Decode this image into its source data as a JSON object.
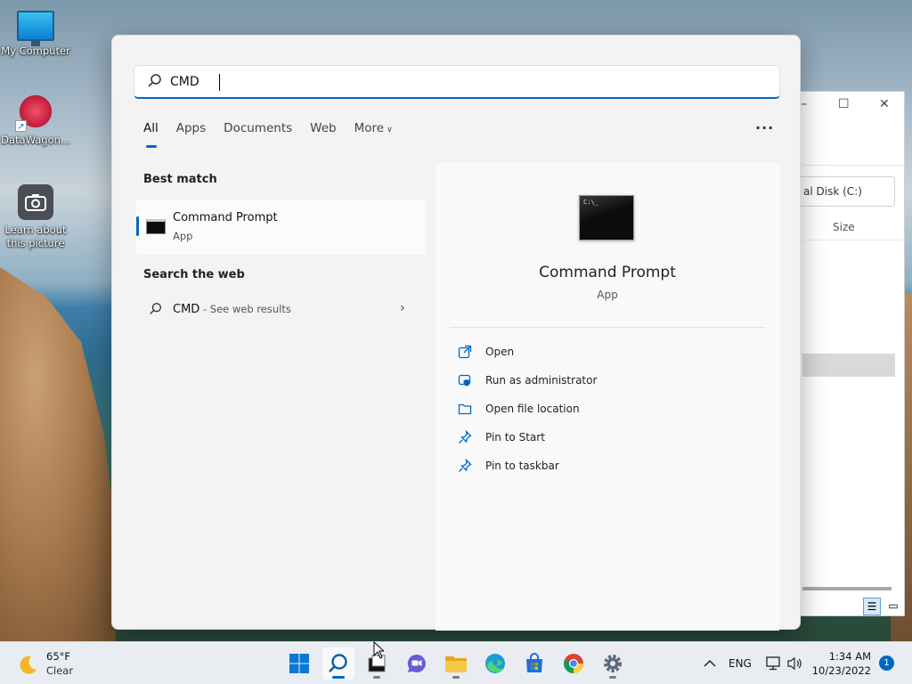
{
  "desktop": {
    "icons": [
      {
        "label": "My Computer"
      },
      {
        "label": "DataWagon..."
      },
      {
        "label": "Learn about this picture"
      }
    ]
  },
  "explorer": {
    "address": "al Disk (C:)",
    "column_size": "Size"
  },
  "search": {
    "query": "CMD",
    "tabs": [
      {
        "label": "All",
        "active": true
      },
      {
        "label": "Apps"
      },
      {
        "label": "Documents"
      },
      {
        "label": "Web"
      },
      {
        "label": "More"
      }
    ],
    "more_options": "···",
    "best_match_title": "Best match",
    "best_match": {
      "name": "Command Prompt",
      "type": "App",
      "icon": "cmd-icon"
    },
    "web_title": "Search the web",
    "web_result": {
      "query": "CMD",
      "hint": " - See web results"
    },
    "preview": {
      "name": "Command Prompt",
      "type": "App",
      "actions": [
        {
          "label": "Open",
          "icon": "open-icon"
        },
        {
          "label": "Run as administrator",
          "icon": "admin-icon"
        },
        {
          "label": "Open file location",
          "icon": "folder-icon"
        },
        {
          "label": "Pin to Start",
          "icon": "pin-icon"
        },
        {
          "label": "Pin to taskbar",
          "icon": "pin-icon"
        }
      ]
    }
  },
  "taskbar": {
    "weather": {
      "temp": "65°F",
      "condition": "Clear"
    },
    "tray": {
      "language": "ENG"
    },
    "clock": {
      "time": "1:34 AM",
      "date": "10/23/2022"
    },
    "notifications": "1"
  },
  "colors": {
    "accent": "#0067c0",
    "panel": "#f3f3f3",
    "taskbar": "#e9edf2"
  }
}
